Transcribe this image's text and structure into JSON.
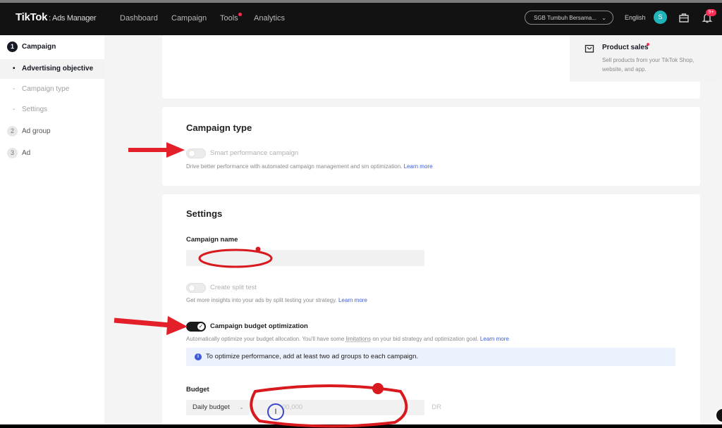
{
  "topbar": {
    "logo": "TikTok",
    "logo_sub": ": Ads Manager",
    "nav": [
      "Dashboard",
      "Campaign",
      "Tools",
      "Analytics"
    ],
    "account": "SGB Tumbuh Bersama...",
    "language": "English",
    "avatar_letter": "S",
    "notification_badge": "9+",
    "accent": "#fe2c55"
  },
  "sidebar": {
    "steps": [
      {
        "num": "1",
        "label": "Campaign"
      },
      {
        "num": "2",
        "label": "Ad group"
      },
      {
        "num": "3",
        "label": "Ad"
      }
    ],
    "campaign_subitems": [
      "Advertising objective",
      "Campaign type",
      "Settings"
    ]
  },
  "objective": {
    "product_sales_title": "Product sales",
    "product_sales_desc": "Sell products from your TikTok Shop, website, and app."
  },
  "campaign_type": {
    "heading": "Campaign type",
    "toggle_label": "Smart performance campaign",
    "desc": "Drive better performance with automated campaign management and sm   optimization.",
    "learn_more": "Learn more"
  },
  "settings": {
    "heading": "Settings",
    "campaign_name_label": "Campaign name",
    "campaign_name_value": "",
    "split_test_label": "Create split test",
    "split_test_desc": "Get more insights into your ads by split testing your strategy.",
    "split_test_link": "Learn more",
    "cbo_label": "Campaign budget optimization",
    "cbo_desc_a": "Automatically optimize your budget allocation. You'll have some",
    "cbo_desc_b": "limitations",
    "cbo_desc_c": "on your bid strategy and optimization goal.",
    "cbo_link": "Learn more",
    "banner_icon": "i",
    "banner": "To optimize performance, add at least two ad groups to each campaign.",
    "budget_label": "Budget",
    "budget_type": "Daily budget",
    "budget_placeholder": "00,000",
    "currency": "DR"
  }
}
